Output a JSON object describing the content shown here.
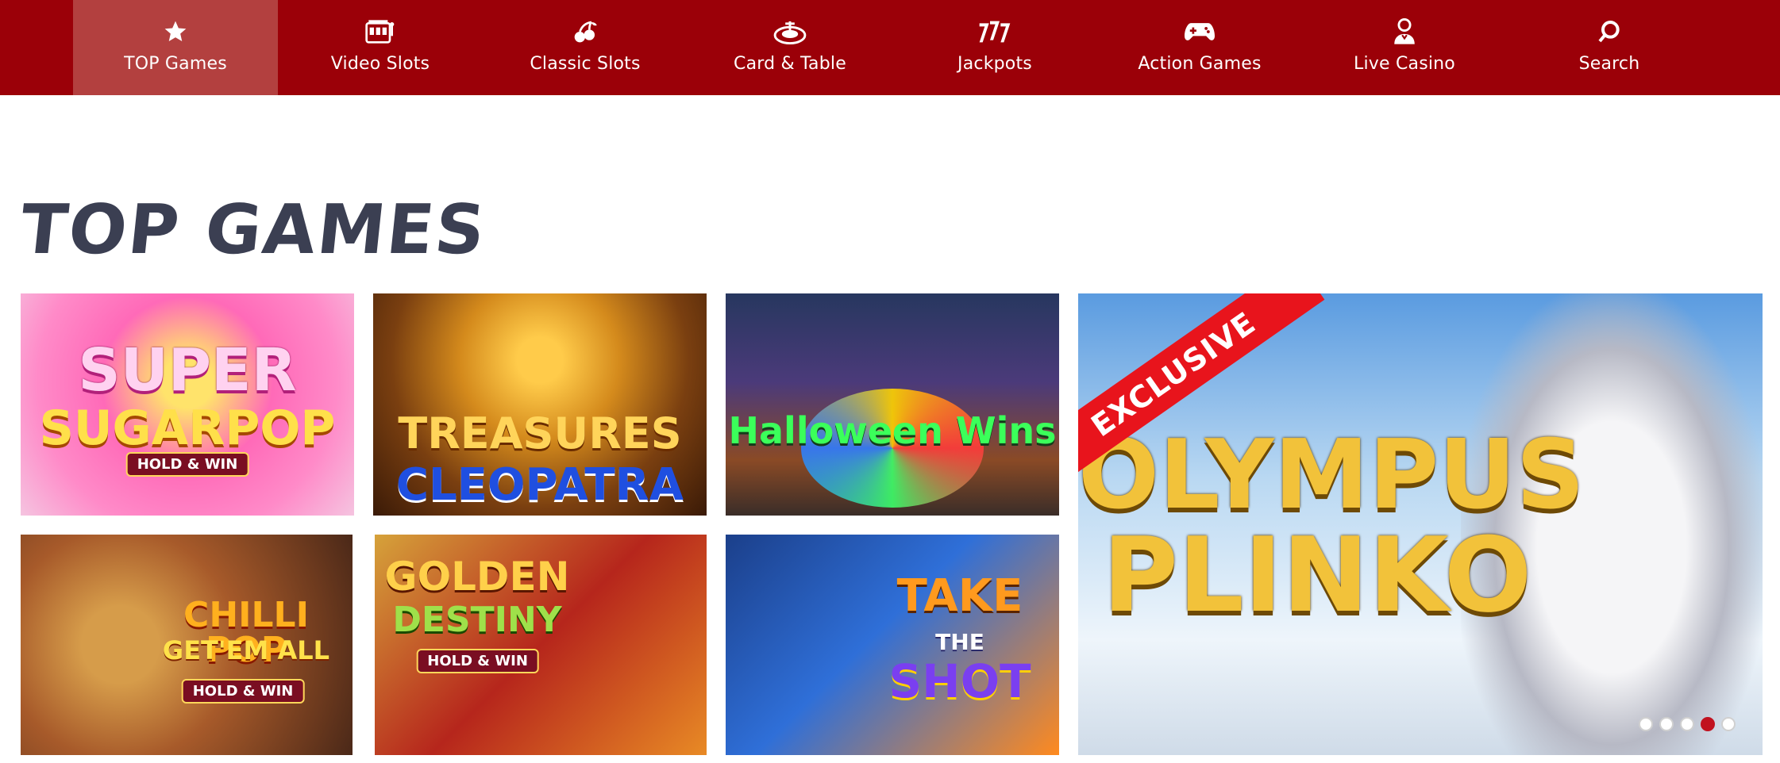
{
  "colors": {
    "nav_bg": "#9b0008",
    "nav_active": "#b3403f",
    "title": "#3b3f52",
    "ribbon": "#e8141c"
  },
  "nav": [
    {
      "label": "TOP Games",
      "icon": "star-icon",
      "active": true
    },
    {
      "label": "Video Slots",
      "icon": "slot-machine-icon",
      "active": false
    },
    {
      "label": "Classic Slots",
      "icon": "cherries-icon",
      "active": false
    },
    {
      "label": "Card & Table",
      "icon": "roulette-icon",
      "active": false
    },
    {
      "label": "Jackpots",
      "icon": "triple-seven-icon",
      "active": false
    },
    {
      "label": "Action Games",
      "icon": "gamepad-icon",
      "active": false
    },
    {
      "label": "Live Casino",
      "icon": "dealer-icon",
      "active": false
    },
    {
      "label": "Search",
      "icon": "search-icon",
      "active": false
    }
  ],
  "section_title": "TOP GAMES",
  "games": [
    {
      "line1": "SUPER",
      "line2": "SUGARPOP",
      "badge": "HOLD & WIN"
    },
    {
      "line1": "TREASURES",
      "line2": "CLEOPATRA"
    },
    {
      "line1": "Halloween Wins"
    },
    {
      "line1": "CHILLI POP",
      "line2": "GET'EM ALL",
      "badge": "HOLD & WIN"
    },
    {
      "line1": "GOLDEN",
      "line2": "DESTINY",
      "badge": "HOLD & WIN"
    },
    {
      "line1": "TAKE",
      "line2": "THE",
      "line3": "SHOT"
    }
  ],
  "featured": {
    "ribbon": "EXCLUSIVE",
    "line1": "OLYMPUS",
    "line2": "PLINKO",
    "slides": 5,
    "active_slide": 4
  }
}
